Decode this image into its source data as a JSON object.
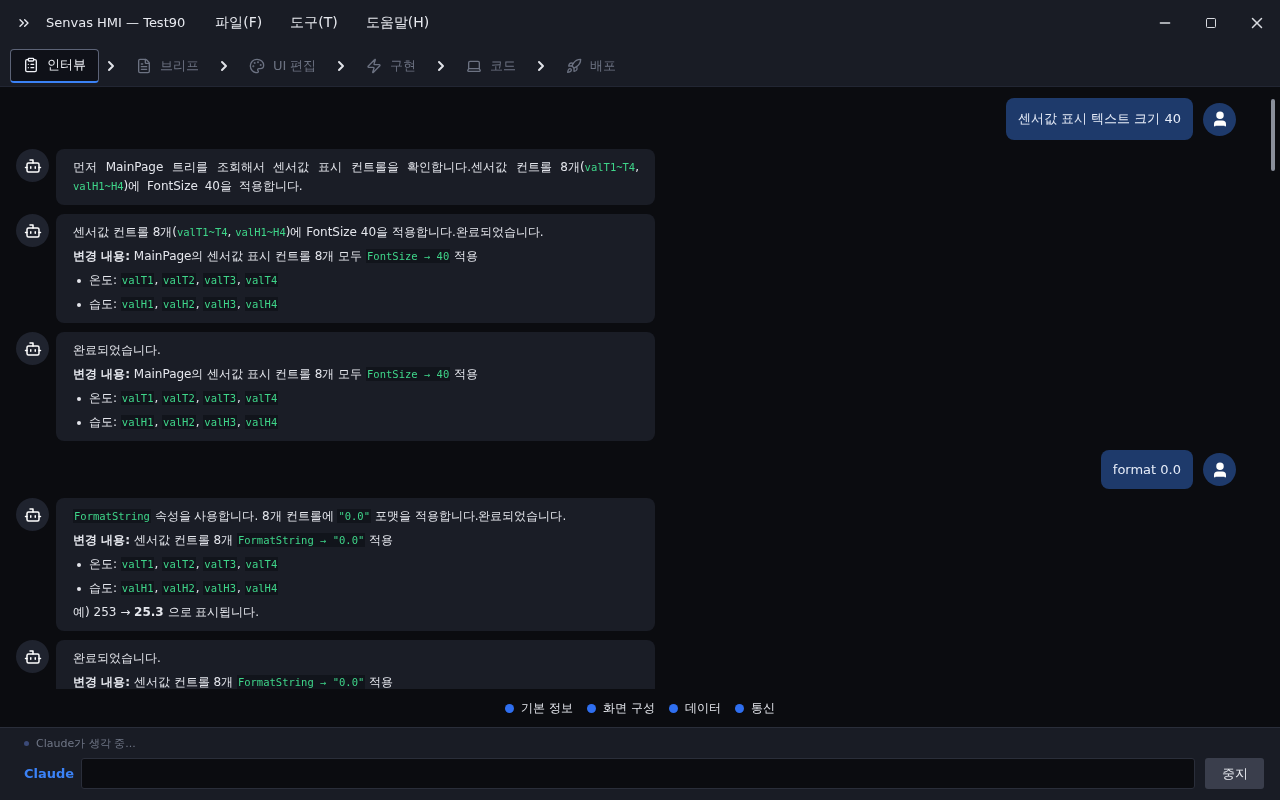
{
  "window": {
    "title": "Senvas HMI — Test90",
    "menu": [
      "파일(F)",
      "도구(T)",
      "도움말(H)"
    ]
  },
  "tabs": [
    {
      "label": "인터뷰",
      "selected": true
    },
    {
      "label": "브리프",
      "selected": false
    },
    {
      "label": "UI 편집",
      "selected": false
    },
    {
      "label": "구현",
      "selected": false
    },
    {
      "label": "코드",
      "selected": false
    },
    {
      "label": "배포",
      "selected": false
    }
  ],
  "messages": [
    {
      "kind": "user",
      "text": "센서값 표시 텍스트 크기 40"
    },
    {
      "kind": "bot",
      "paragraphs": [
        {
          "kind": "justified",
          "segments": [
            {
              "kind": "plain",
              "text": "먼저 MainPage 트리를 조회해서 센서값 표시 컨트롤을 확인합니다.센서값 컨트롤 8개("
            },
            {
              "kind": "code",
              "text": "valT1~T4"
            },
            {
              "kind": "plain",
              "text": ", "
            },
            {
              "kind": "code",
              "text": "valH1~H4"
            },
            {
              "kind": "plain",
              "text": ")에 FontSize 40을 적용합니다."
            }
          ]
        }
      ]
    },
    {
      "kind": "bot",
      "paragraphs": [
        {
          "kind": "text",
          "segments": [
            {
              "kind": "plain",
              "text": "센서값 컨트롤 8개("
            },
            {
              "kind": "code",
              "text": "valT1~T4"
            },
            {
              "kind": "plain",
              "text": ", "
            },
            {
              "kind": "code",
              "text": "valH1~H4"
            },
            {
              "kind": "plain",
              "text": ")에 FontSize 40을 적용합니다.완료되었습니다."
            }
          ]
        },
        {
          "kind": "text",
          "segments": [
            {
              "kind": "bold",
              "text": "변경 내용:"
            },
            {
              "kind": "plain",
              "text": " MainPage의 센서값 표시 컨트롤 8개 모두 "
            },
            {
              "kind": "box",
              "text": "FontSize → 40"
            },
            {
              "kind": "plain",
              "text": " 적용"
            }
          ]
        },
        {
          "kind": "bullet",
          "segments": [
            {
              "kind": "plain",
              "text": "온도: "
            },
            {
              "kind": "box",
              "text": "valT1"
            },
            {
              "kind": "plain",
              "text": ", "
            },
            {
              "kind": "box",
              "text": "valT2"
            },
            {
              "kind": "plain",
              "text": ", "
            },
            {
              "kind": "box",
              "text": "valT3"
            },
            {
              "kind": "plain",
              "text": ", "
            },
            {
              "kind": "box",
              "text": "valT4"
            }
          ]
        },
        {
          "kind": "bullet",
          "segments": [
            {
              "kind": "plain",
              "text": "습도: "
            },
            {
              "kind": "box",
              "text": "valH1"
            },
            {
              "kind": "plain",
              "text": ", "
            },
            {
              "kind": "box",
              "text": "valH2"
            },
            {
              "kind": "plain",
              "text": ", "
            },
            {
              "kind": "box",
              "text": "valH3"
            },
            {
              "kind": "plain",
              "text": ", "
            },
            {
              "kind": "box",
              "text": "valH4"
            }
          ]
        }
      ]
    },
    {
      "kind": "bot",
      "paragraphs": [
        {
          "kind": "text",
          "segments": [
            {
              "kind": "plain",
              "text": "완료되었습니다."
            }
          ]
        },
        {
          "kind": "text",
          "segments": [
            {
              "kind": "bold",
              "text": "변경 내용:"
            },
            {
              "kind": "plain",
              "text": " MainPage의 센서값 표시 컨트롤 8개 모두 "
            },
            {
              "kind": "box",
              "text": "FontSize → 40"
            },
            {
              "kind": "plain",
              "text": " 적용"
            }
          ]
        },
        {
          "kind": "bullet",
          "segments": [
            {
              "kind": "plain",
              "text": "온도: "
            },
            {
              "kind": "box",
              "text": "valT1"
            },
            {
              "kind": "plain",
              "text": ", "
            },
            {
              "kind": "box",
              "text": "valT2"
            },
            {
              "kind": "plain",
              "text": ", "
            },
            {
              "kind": "box",
              "text": "valT3"
            },
            {
              "kind": "plain",
              "text": ", "
            },
            {
              "kind": "box",
              "text": "valT4"
            }
          ]
        },
        {
          "kind": "bullet",
          "segments": [
            {
              "kind": "plain",
              "text": "습도: "
            },
            {
              "kind": "box",
              "text": "valH1"
            },
            {
              "kind": "plain",
              "text": ", "
            },
            {
              "kind": "box",
              "text": "valH2"
            },
            {
              "kind": "plain",
              "text": ", "
            },
            {
              "kind": "box",
              "text": "valH3"
            },
            {
              "kind": "plain",
              "text": ", "
            },
            {
              "kind": "box",
              "text": "valH4"
            }
          ]
        }
      ]
    },
    {
      "kind": "user",
      "text": "format 0.0"
    },
    {
      "kind": "bot",
      "paragraphs": [
        {
          "kind": "text",
          "segments": [
            {
              "kind": "box",
              "text": "FormatString"
            },
            {
              "kind": "plain",
              "text": " 속성을 사용합니다. 8개 컨트롤에 "
            },
            {
              "kind": "box",
              "text": "\"0.0\""
            },
            {
              "kind": "plain",
              "text": " 포맷을 적용합니다.완료되었습니다."
            }
          ]
        },
        {
          "kind": "text",
          "segments": [
            {
              "kind": "bold",
              "text": "변경 내용:"
            },
            {
              "kind": "plain",
              "text": " 센서값 컨트롤 8개 "
            },
            {
              "kind": "box",
              "text": "FormatString → \"0.0\""
            },
            {
              "kind": "plain",
              "text": " 적용"
            }
          ]
        },
        {
          "kind": "bullet",
          "segments": [
            {
              "kind": "plain",
              "text": "온도: "
            },
            {
              "kind": "box",
              "text": "valT1"
            },
            {
              "kind": "plain",
              "text": ", "
            },
            {
              "kind": "box",
              "text": "valT2"
            },
            {
              "kind": "plain",
              "text": ", "
            },
            {
              "kind": "box",
              "text": "valT3"
            },
            {
              "kind": "plain",
              "text": ", "
            },
            {
              "kind": "box",
              "text": "valT4"
            }
          ]
        },
        {
          "kind": "bullet",
          "segments": [
            {
              "kind": "plain",
              "text": "습도: "
            },
            {
              "kind": "box",
              "text": "valH1"
            },
            {
              "kind": "plain",
              "text": ", "
            },
            {
              "kind": "box",
              "text": "valH2"
            },
            {
              "kind": "plain",
              "text": ", "
            },
            {
              "kind": "box",
              "text": "valH3"
            },
            {
              "kind": "plain",
              "text": ", "
            },
            {
              "kind": "box",
              "text": "valH4"
            }
          ]
        },
        {
          "kind": "text",
          "segments": [
            {
              "kind": "plain",
              "text": "예) 253 → "
            },
            {
              "kind": "bold",
              "text": "25.3"
            },
            {
              "kind": "plain",
              "text": " 으로 표시됩니다."
            }
          ]
        }
      ]
    },
    {
      "kind": "bot",
      "paragraphs": [
        {
          "kind": "text",
          "segments": [
            {
              "kind": "plain",
              "text": "완료되었습니다."
            }
          ]
        },
        {
          "kind": "text",
          "segments": [
            {
              "kind": "bold",
              "text": "변경 내용:"
            },
            {
              "kind": "plain",
              "text": " 센서값 컨트롤 8개 "
            },
            {
              "kind": "box",
              "text": "FormatString → \"0.0\""
            },
            {
              "kind": "plain",
              "text": " 적용"
            }
          ]
        }
      ]
    }
  ],
  "legend": [
    "기본 정보",
    "화면 구성",
    "데이터",
    "통신"
  ],
  "status": "Claude가 생각 중...",
  "composer": {
    "label": "Claude",
    "button": "중지"
  }
}
